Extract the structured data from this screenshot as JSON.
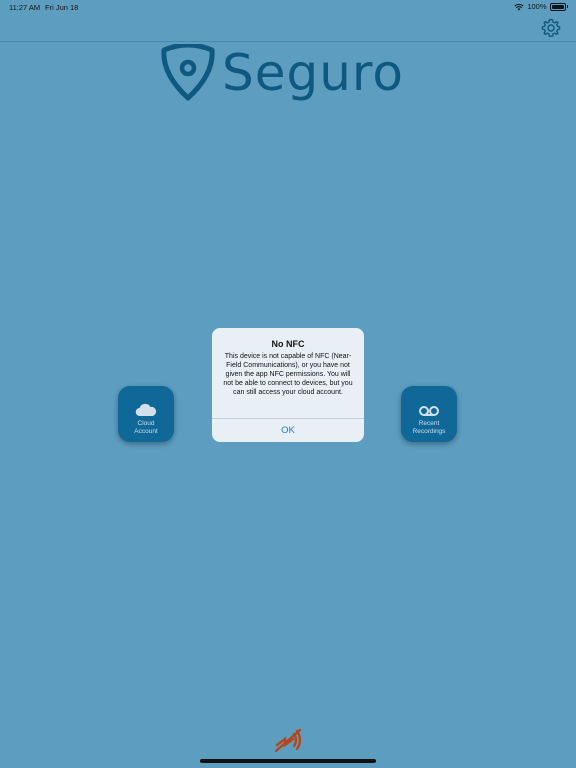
{
  "status_bar": {
    "time": "11:27 AM",
    "date": "Fri Jun 18",
    "battery": "100%",
    "wifi_icon": "wifi-icon"
  },
  "nav": {
    "settings_icon": "gear-icon"
  },
  "logo": {
    "text": "Seguro",
    "icon": "shield-icon",
    "color": "#0e5a82"
  },
  "tiles": {
    "cloud": {
      "icon": "cloud-icon",
      "label_line1": "Cloud",
      "label_line2": "Account"
    },
    "recordings": {
      "icon": "voicemail-icon",
      "label_line1": "Recent",
      "label_line2": "Recordings"
    }
  },
  "alert": {
    "title": "No NFC",
    "message": "This device is not capable of NFC (Near-Field Communications), or you have not given the app NFC permissions. You will not be able to connect to devices, but you can still access your cloud account.",
    "ok_label": "OK",
    "ok_color": "#1a7be0"
  },
  "footer": {
    "nfc_status_icon": "nfc-disabled-icon",
    "nfc_color": "#b5471c"
  },
  "colors": {
    "background": "#62a5c7",
    "tile": "#0f6b9c"
  }
}
